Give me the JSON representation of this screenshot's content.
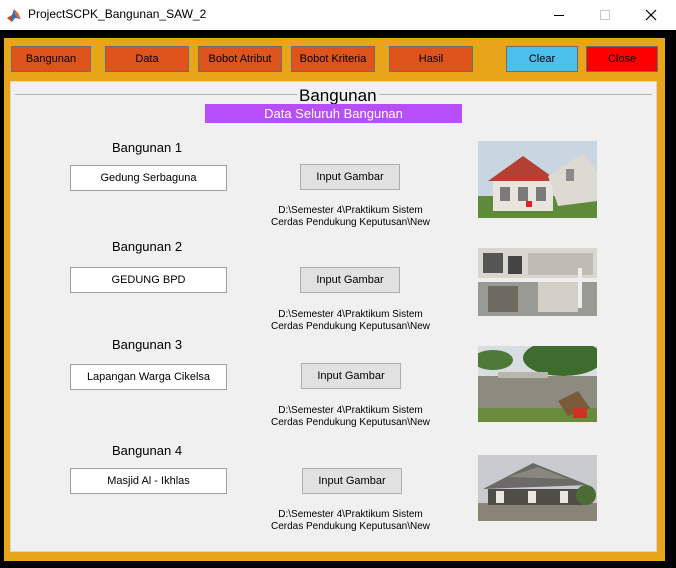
{
  "window": {
    "title": "ProjectSCPK_Bangunan_SAW_2"
  },
  "toolbar": {
    "bangunan": "Bangunan",
    "data": "Data",
    "bobot_atribut": "Bobot Atribut",
    "bobot_kriteria": "Bobot Kriteria",
    "hasil": "Hasil",
    "clear": "Clear",
    "close": "Close"
  },
  "panel": {
    "title": "Bangunan",
    "subtitle": "Data Seluruh Bangunan"
  },
  "buildings": [
    {
      "label": "Bangunan 1",
      "name": "Gedung Serbaguna",
      "button": "Input Gambar",
      "path": "D:\\Semester 4\\Praktikum Sistem Cerdas Pendukung Keputusan\\New"
    },
    {
      "label": "Bangunan 2",
      "name": "GEDUNG BPD",
      "button": "Input Gambar",
      "path": "D:\\Semester 4\\Praktikum Sistem Cerdas Pendukung Keputusan\\New"
    },
    {
      "label": "Bangunan 3",
      "name": "Lapangan Warga Cikelsa",
      "button": "Input Gambar",
      "path": "D:\\Semester 4\\Praktikum Sistem Cerdas Pendukung Keputusan\\New"
    },
    {
      "label": "Bangunan 4",
      "name": "Masjid Al - Ikhlas",
      "button": "Input Gambar",
      "path": "D:\\Semester 4\\Praktikum Sistem Cerdas Pendukung Keputusan\\New"
    }
  ],
  "colors": {
    "frame": "#e8a51a",
    "nav_button": "#de541c",
    "clear_button": "#4cbfec",
    "close_button": "#ff0000",
    "subtitle_bg": "#b84ef9"
  },
  "icons": {
    "app": "matlab-icon",
    "minimize": "minimize-icon",
    "maximize": "maximize-icon",
    "close": "close-icon"
  }
}
